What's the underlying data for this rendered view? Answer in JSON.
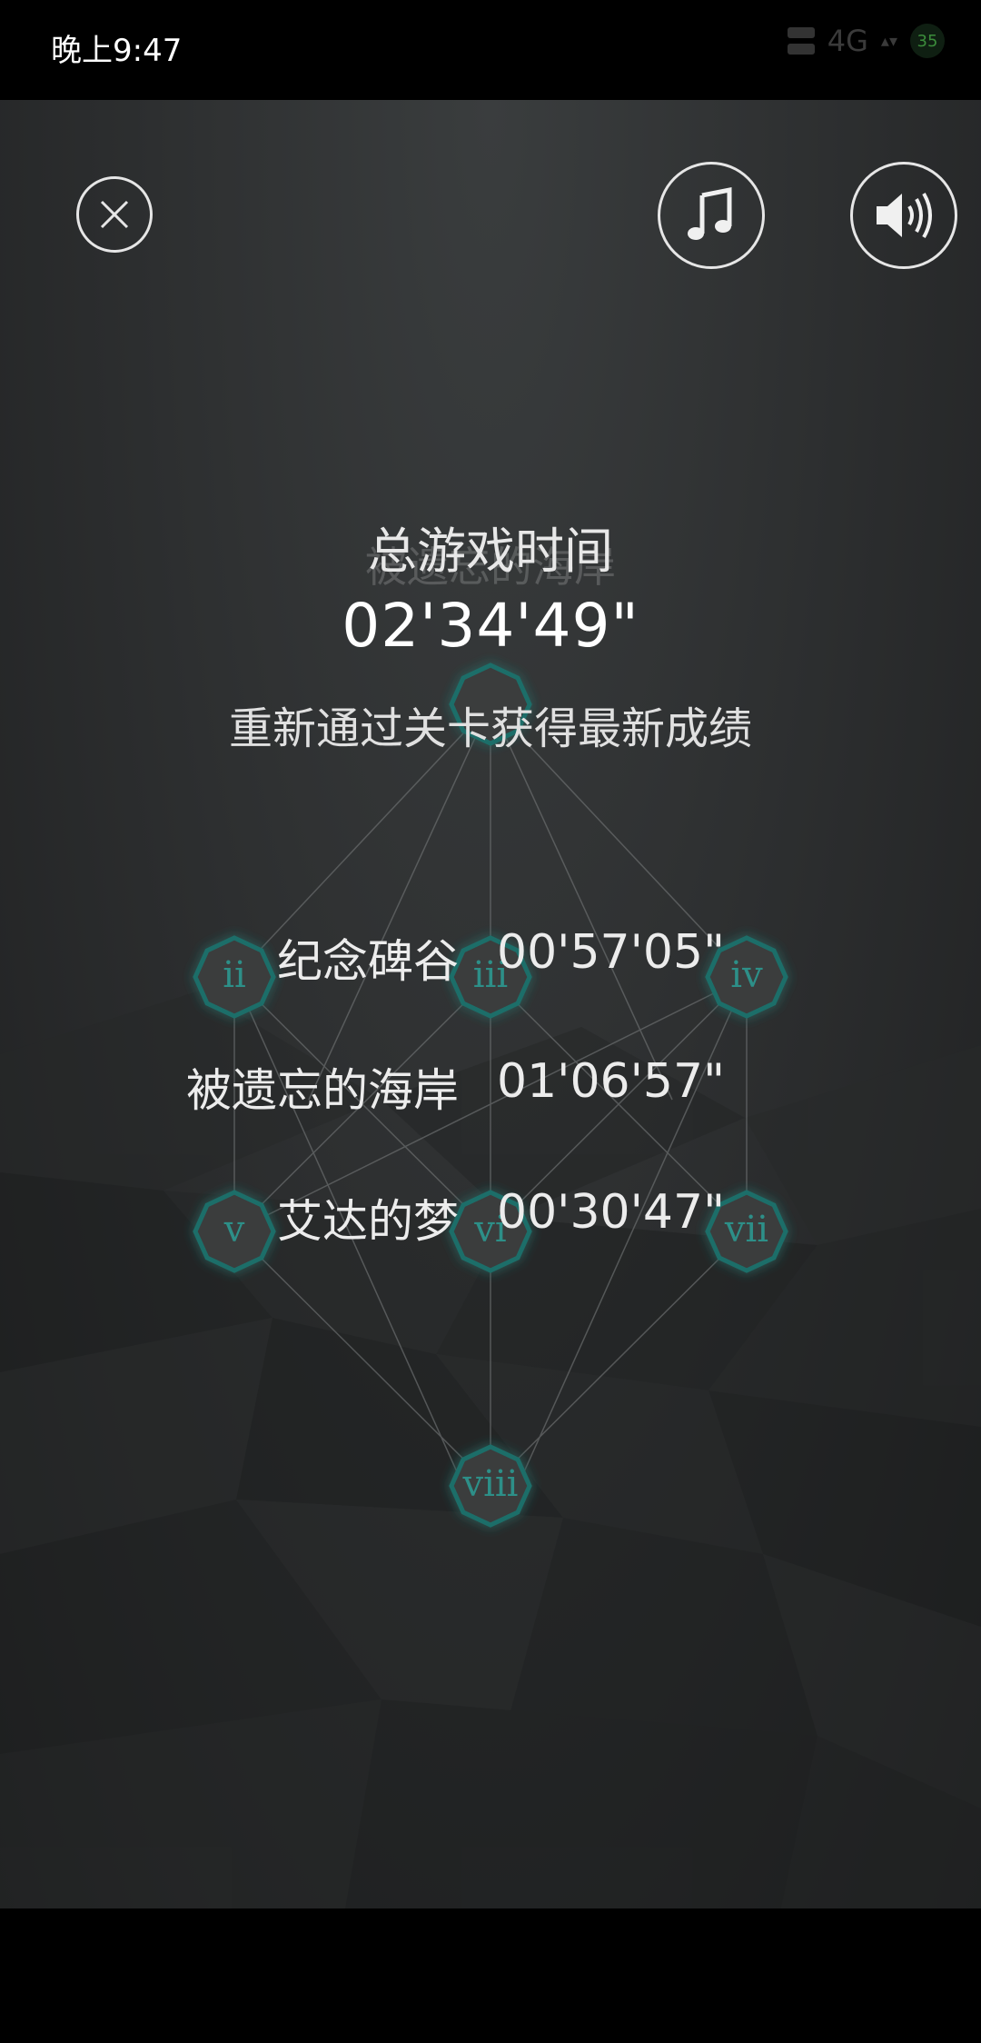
{
  "status_bar": {
    "time": "晚上9:47",
    "network": "4G",
    "battery": "35"
  },
  "toolbar": {
    "close_icon": "close-icon",
    "music_icon": "music-note-icon",
    "sound_icon": "speaker-icon"
  },
  "summary": {
    "ghost_title": "被遗忘的海岸",
    "title": "总游戏时间",
    "total_time": "02'34'49\"",
    "subtitle": "重新通过关卡获得最新成绩"
  },
  "scores": [
    {
      "name": "纪念碑谷",
      "time": "00'57'05\""
    },
    {
      "name": "被遗忘的海岸",
      "time": "01'06'57\""
    },
    {
      "name": "艾达的梦",
      "time": "00'30'47\""
    }
  ],
  "chapter_nodes": [
    {
      "id": "i",
      "label": ""
    },
    {
      "id": "ii",
      "label": "ii"
    },
    {
      "id": "iii",
      "label": "iii"
    },
    {
      "id": "iv",
      "label": "iv"
    },
    {
      "id": "v",
      "label": "v"
    },
    {
      "id": "vi",
      "label": "vi"
    },
    {
      "id": "vii",
      "label": "vii"
    },
    {
      "id": "viii",
      "label": "viii"
    }
  ],
  "colors": {
    "node_fill": "#3a3d3e",
    "node_stroke": "#1f6e69",
    "node_glow": "#3aa49b",
    "node_text": "#2d8f88"
  }
}
